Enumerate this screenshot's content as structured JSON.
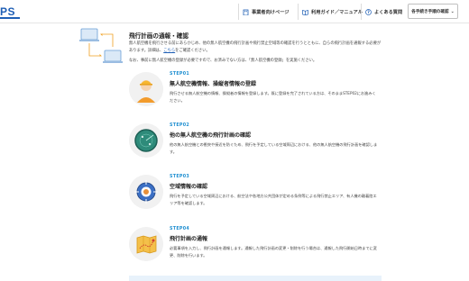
{
  "header": {
    "logo": "PS",
    "nav": [
      {
        "label": "事業者向けページ",
        "icon": "building-icon"
      },
      {
        "label": "利用ガイド／マニュアル",
        "icon": "book-icon"
      },
      {
        "label": "よくある質問",
        "icon": "question-icon"
      }
    ],
    "procedure_button": "各手続き手順の確認",
    "chevron": "⌄"
  },
  "intro": {
    "title": "飛行計画の通報・確認",
    "text_1": "無人航空機を飛行させる前にあらかじめ、他の無人航空機の飛行計画や飛行禁止空域等の確認を行うとともに、自ら",
    "text_2": "の飛行計画を通報する必要があります。詳細は、",
    "link": "こちら",
    "text_3": "をご確認ください。",
    "note": "なお、事前に無人航空機の登録が必要ですので、お済みでない方は、「無人航空機の登録」を実施ください。"
  },
  "steps": [
    {
      "label": "STEP01",
      "title": "無人航空機情報、操縦者情報の登録",
      "desc": "飛行させる無人航空機の情報、操縦者の情報を登録します。既に登録を完了されている方は、そのままSTEP02にお進みください。",
      "icon": "operator-icon"
    },
    {
      "label": "STEP02",
      "title": "他の無人航空機の飛行計画の確認",
      "desc": "他の無人航空機との衝突や接近を防ぐため、飛行を予定している空域周辺における、他の無人航空機の飛行計画を確認します。",
      "icon": "radar-icon"
    },
    {
      "label": "STEP03",
      "title": "空域情報の確認",
      "desc": "飛行を予定している空域周辺における、航空法や各地方公共団体が定める条例等による飛行禁止エリア、有人機の離着陸エリア等を確認します。",
      "icon": "target-icon"
    },
    {
      "label": "STEP04",
      "title": "飛行計画の通報",
      "desc": "必要事項を入力し、飛行計画を通報します。通報した飛行計画の変更・削除を行う場合は、通報した飛行開始日時までに変更、削除を行います。",
      "icon": "map-icon"
    }
  ]
}
